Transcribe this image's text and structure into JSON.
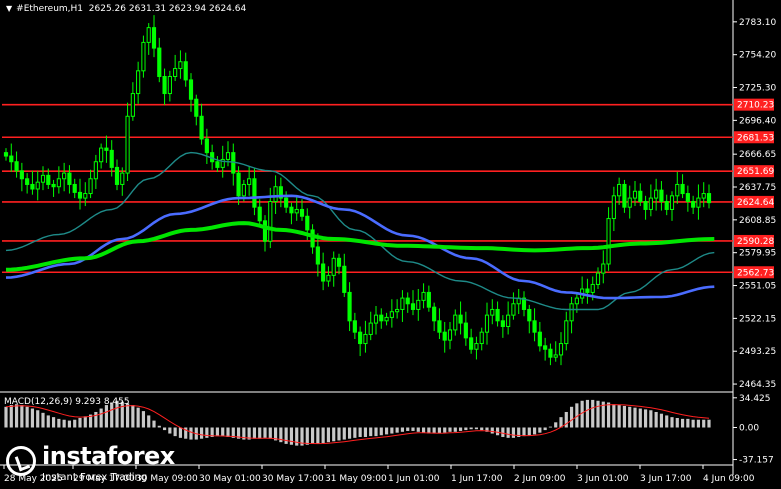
{
  "header": {
    "symbol": "#Ethereum,H1",
    "ohlc": "2625.26 2631.31 2623.94 2624.64"
  },
  "macd_header": "MACD(12,26,9) 9.293 8.455",
  "logo": {
    "brand": "instaforex",
    "tagline": "Instant Forex Trading"
  },
  "colors": {
    "background": "#000000",
    "candle": "#00ff00",
    "resistance": "#ff2020",
    "ma_fast": "#1e8a88",
    "ma_mid": "#00e600",
    "ma_slow": "#4a6cff",
    "macd_hist": "#c8c8c8",
    "macd_signal": "#ff2020"
  },
  "chart_data": {
    "type": "candlestick",
    "price_axis_ticks": [
      "2783.10",
      "2754.20",
      "2725.30",
      "2696.40",
      "2666.65",
      "2637.75",
      "2608.85",
      "2579.95",
      "2551.05",
      "2522.15",
      "2493.25",
      "2464.35"
    ],
    "y_range": [
      2460,
      2790
    ],
    "time_axis_labels": [
      "28 May 2025",
      "29 May 17:00",
      "30 May 09:00",
      "30 May 01:00",
      "30 May 17:00",
      "31 May 09:00",
      "1 Jun 01:00",
      "1 Jun 17:00",
      "2 Jun 09:00",
      "3 Jun 01:00",
      "3 Jun 17:00",
      "4 Jun 09:00"
    ],
    "horizontal_levels": [
      {
        "price": 2710.23,
        "label": "2710.23"
      },
      {
        "price": 2681.53,
        "label": "2681.53"
      },
      {
        "price": 2651.69,
        "label": "2651.69"
      },
      {
        "price": 2624.64,
        "label": "2624.64"
      },
      {
        "price": 2590.28,
        "label": "2590.28"
      },
      {
        "price": 2562.73,
        "label": "2562.73"
      }
    ],
    "close_prices": [
      2665,
      2660,
      2652,
      2645,
      2640,
      2636,
      2642,
      2648,
      2640,
      2638,
      2645,
      2650,
      2640,
      2633,
      2628,
      2632,
      2645,
      2660,
      2672,
      2670,
      2655,
      2640,
      2650,
      2700,
      2720,
      2740,
      2765,
      2778,
      2760,
      2735,
      2720,
      2735,
      2742,
      2748,
      2732,
      2715,
      2700,
      2680,
      2668,
      2660,
      2655,
      2662,
      2668,
      2650,
      2630,
      2640,
      2645,
      2620,
      2608,
      2590,
      2625,
      2638,
      2628,
      2620,
      2615,
      2618,
      2612,
      2600,
      2585,
      2570,
      2555,
      2560,
      2575,
      2568,
      2545,
      2520,
      2510,
      2500,
      2508,
      2518,
      2525,
      2520,
      2523,
      2528,
      2530,
      2540,
      2535,
      2530,
      2538,
      2545,
      2532,
      2520,
      2510,
      2503,
      2512,
      2525,
      2518,
      2505,
      2495,
      2500,
      2510,
      2525,
      2530,
      2520,
      2515,
      2525,
      2535,
      2540,
      2530,
      2520,
      2510,
      2498,
      2495,
      2488,
      2490,
      2500,
      2520,
      2535,
      2540,
      2548,
      2545,
      2552,
      2562,
      2570,
      2610,
      2630,
      2640,
      2620,
      2628,
      2634,
      2625,
      2618,
      2628,
      2635,
      2625,
      2618,
      2630,
      2640,
      2632,
      2625,
      2620,
      2628,
      2632,
      2624
    ],
    "indicators": {
      "ma_fast_anchors": [
        [
          0,
          2582
        ],
        [
          10,
          2596
        ],
        [
          20,
          2618
        ],
        [
          27,
          2645
        ],
        [
          35,
          2668
        ],
        [
          42,
          2660
        ],
        [
          50,
          2652
        ],
        [
          58,
          2630
        ],
        [
          66,
          2600
        ],
        [
          76,
          2572
        ],
        [
          86,
          2555
        ],
        [
          96,
          2540
        ],
        [
          106,
          2530
        ],
        [
          112,
          2530
        ],
        [
          118,
          2545
        ],
        [
          126,
          2565
        ],
        [
          134,
          2580
        ]
      ],
      "ma_mid_anchors": [
        [
          0,
          2565
        ],
        [
          15,
          2575
        ],
        [
          25,
          2590
        ],
        [
          35,
          2600
        ],
        [
          45,
          2606
        ],
        [
          52,
          2600
        ],
        [
          62,
          2592
        ],
        [
          75,
          2586
        ],
        [
          90,
          2584
        ],
        [
          100,
          2582
        ],
        [
          110,
          2584
        ],
        [
          120,
          2588
        ],
        [
          134,
          2592
        ]
      ],
      "ma_slow_anchors": [
        [
          0,
          2558
        ],
        [
          12,
          2570
        ],
        [
          22,
          2592
        ],
        [
          32,
          2614
        ],
        [
          44,
          2628
        ],
        [
          54,
          2630
        ],
        [
          64,
          2618
        ],
        [
          76,
          2595
        ],
        [
          88,
          2575
        ],
        [
          98,
          2555
        ],
        [
          106,
          2545
        ],
        [
          114,
          2540
        ],
        [
          124,
          2541
        ],
        [
          134,
          2550
        ]
      ]
    },
    "macd": {
      "axis_ticks": [
        "34.425",
        "0.00",
        "-37.157"
      ],
      "y_range": [
        -40,
        40
      ],
      "histogram": [
        24,
        26,
        27,
        26,
        24,
        22,
        20,
        17,
        14,
        12,
        10,
        9,
        8,
        9,
        11,
        13,
        15,
        18,
        22,
        26,
        29,
        31,
        30,
        28,
        26,
        23,
        19,
        14,
        8,
        2,
        -3,
        -7,
        -10,
        -12,
        -13,
        -14,
        -14,
        -13,
        -12,
        -11,
        -10,
        -10,
        -11,
        -12,
        -13,
        -14,
        -14,
        -13,
        -13,
        -12,
        -13,
        -15,
        -17,
        -19,
        -20,
        -21,
        -21,
        -20,
        -19,
        -19,
        -18,
        -17,
        -16,
        -15,
        -14,
        -13,
        -12,
        -11,
        -11,
        -10,
        -10,
        -9,
        -8,
        -7,
        -6,
        -5,
        -4,
        -4,
        -5,
        -6,
        -7,
        -7,
        -7,
        -6,
        -5,
        -5,
        -4,
        -3,
        -2,
        -2,
        -3,
        -5,
        -7,
        -9,
        -11,
        -12,
        -12,
        -11,
        -10,
        -9,
        -8,
        -6,
        -3,
        1,
        6,
        12,
        18,
        24,
        28,
        31,
        32,
        32,
        31,
        30,
        29,
        27,
        26,
        25,
        24,
        23,
        22,
        21,
        20,
        18,
        16,
        14,
        12,
        11,
        10,
        10,
        9,
        9,
        9,
        9,
        9
      ]
    }
  }
}
